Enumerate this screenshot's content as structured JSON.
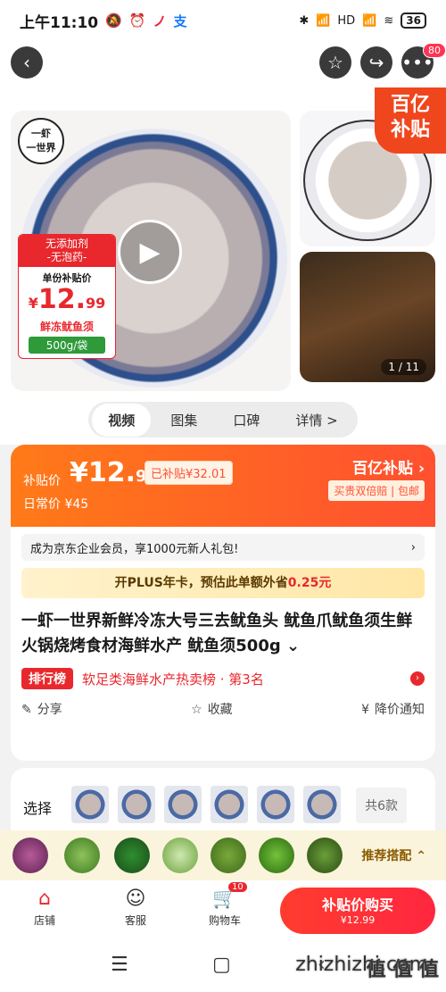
{
  "status": {
    "time": "上午11:10",
    "battery": "36",
    "left_icons": [
      "🔕",
      "⏰",
      "ノ",
      "支"
    ],
    "right_icons": [
      "✱",
      "📶",
      "HD",
      "📶",
      "≋"
    ]
  },
  "appbar": {
    "more_badge": "80"
  },
  "gallery": {
    "logo_text": "一虾\n一世界",
    "tag_top": "无添加剂\n-无泡药-",
    "tag_label": "单份补贴价",
    "tag_currency": "¥",
    "tag_price_int": "12.",
    "tag_price_dec": "99",
    "tag_name": "鲜冻鱿鱼须",
    "tag_spec": "500g/袋",
    "biyi_line1": "百亿",
    "biyi_line2": "补贴",
    "image_count": "1 / 11"
  },
  "tabs": [
    {
      "label": "视频",
      "active": true
    },
    {
      "label": "图集",
      "active": false
    },
    {
      "label": "口碑",
      "active": false
    },
    {
      "label": "详情 >",
      "active": false
    }
  ],
  "price": {
    "label": "补贴价",
    "value_int": "¥12.",
    "value_dec": "99",
    "subsidy": "已补贴¥32.01",
    "daily": "日常价 ¥45",
    "brand": "百亿补贴 ›",
    "brand_sub": "买贵双倍赔 | 包邮"
  },
  "member_text": "成为京东企业会员，享1000元新人礼包!",
  "member_arrow": "›",
  "plus": {
    "text": "开PLUS年卡，预估此单额外省",
    "highlight": "0.25元"
  },
  "title": "一虾一世界新鲜冷冻大号三去鱿鱼头 鱿鱼爪鱿鱼须生鲜火锅烧烤食材海鲜水产 鱿鱼须500g ⌄",
  "rank": {
    "badge": "排行榜",
    "text": "软足类海鲜水产热卖榜 · 第3名",
    "arrow": "›"
  },
  "actions": [
    {
      "icon": "✎",
      "label": "分享"
    },
    {
      "icon": "☆",
      "label": "收藏"
    },
    {
      "icon": "¥",
      "label": "降价通知"
    }
  ],
  "select": {
    "label": "选择",
    "more": "共6款"
  },
  "recommend": {
    "text": "推荐搭配 ⌃"
  },
  "bottom": {
    "store": "店铺",
    "service": "客服",
    "cart": "购物车",
    "cart_badge": "10",
    "buy_line1": "补贴价购买",
    "buy_line2": "¥12.99"
  },
  "watermark": {
    "big": "值 值 值",
    "small": "zhizhizhi.com"
  }
}
